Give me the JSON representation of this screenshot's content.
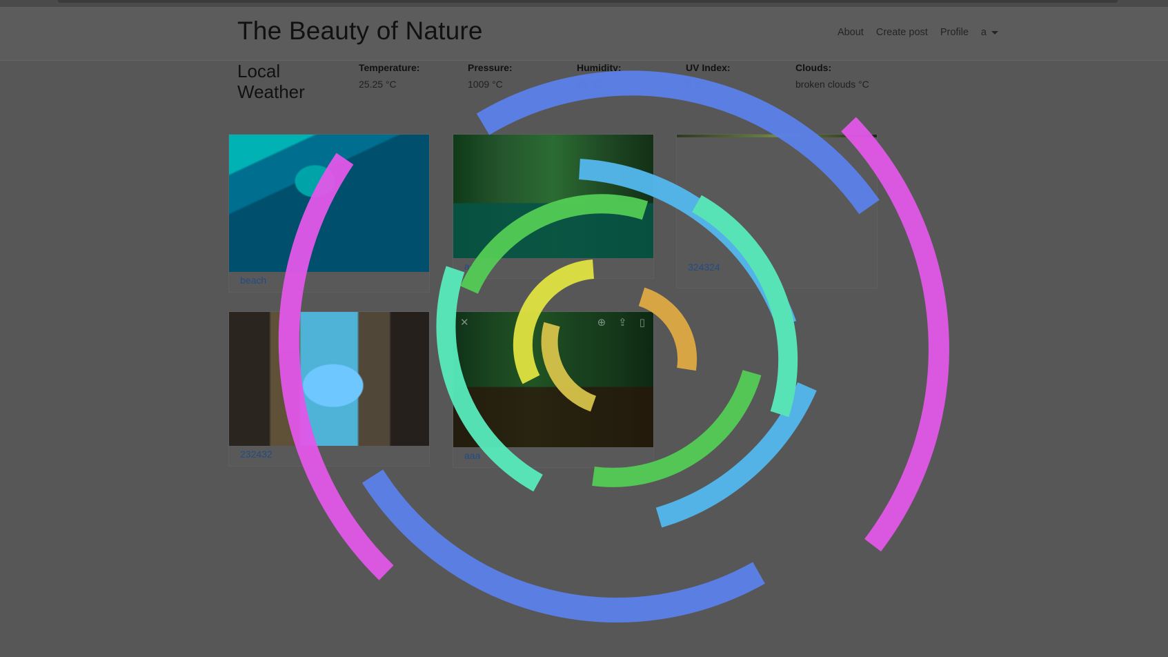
{
  "navbar": {
    "brand": "The Beauty of Nature",
    "links": [
      "About",
      "Create post",
      "Profile"
    ],
    "dropdown_label": "a"
  },
  "weather": {
    "title": "Local Weather",
    "metrics": [
      {
        "label": "Temperature:",
        "value": "25.25 °C"
      },
      {
        "label": "Pressure:",
        "value": "1009 °C"
      },
      {
        "label": "Humidity:",
        "value": "88 °C"
      },
      {
        "label": "UV Index:",
        "value": "0 °C"
      },
      {
        "label": "Clouds:",
        "value": "broken clouds °C"
      }
    ]
  },
  "posts": [
    {
      "caption": "beach"
    },
    {
      "caption": "aa"
    },
    {
      "caption": "324324"
    },
    {
      "caption": "232432"
    },
    {
      "caption": "aaa"
    }
  ],
  "icons": {
    "close": "close-icon",
    "zoom": "zoom-icon",
    "share": "share-icon",
    "bookmark": "bookmark-icon"
  }
}
